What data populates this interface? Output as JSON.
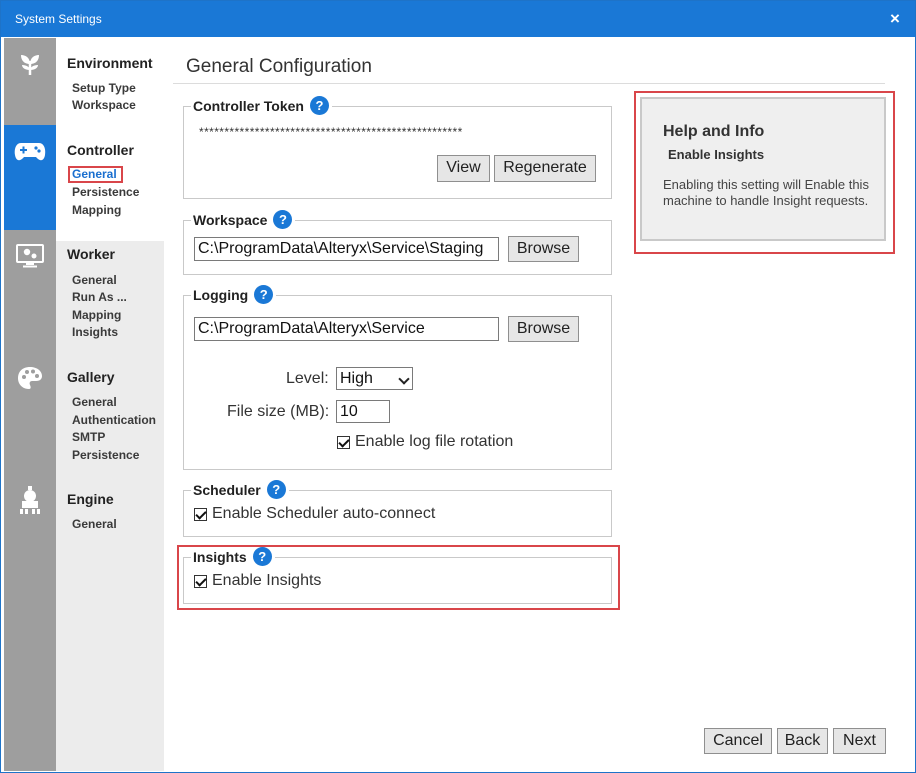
{
  "window": {
    "title": "System Settings",
    "close_glyph": "×"
  },
  "rail": {
    "icons": [
      "sprout-icon",
      "gamepad-icon",
      "monitor-gear-icon",
      "palette-icon",
      "engine-icon"
    ],
    "active_color": "#1a78d6"
  },
  "nav": {
    "sections": [
      {
        "title": "Environment",
        "items": [
          "Setup Type",
          "Workspace"
        ]
      },
      {
        "title": "Controller",
        "items": [
          "General",
          "Persistence",
          "Mapping"
        ]
      },
      {
        "title": "Worker",
        "items": [
          "General",
          "Run As ...",
          "Mapping",
          "Insights"
        ]
      },
      {
        "title": "Gallery",
        "items": [
          "General",
          "Authentication",
          "SMTP",
          "Persistence"
        ]
      },
      {
        "title": "Engine",
        "items": [
          "General"
        ]
      }
    ],
    "selected": "General"
  },
  "main": {
    "heading": "General Configuration",
    "controller_token": {
      "legend": "Controller Token",
      "token_value": "****************************************************",
      "view_label": "View",
      "regenerate_label": "Regenerate"
    },
    "workspace": {
      "legend": "Workspace",
      "path": "C:\\ProgramData\\Alteryx\\Service\\Staging",
      "browse_label": "Browse"
    },
    "logging": {
      "legend": "Logging",
      "path": "C:\\ProgramData\\Alteryx\\Service",
      "browse_label": "Browse",
      "level_label": "Level:",
      "level_value": "High",
      "file_size_label": "File size (MB):",
      "file_size_value": "10",
      "rotation_label": "Enable log file rotation"
    },
    "scheduler": {
      "legend": "Scheduler",
      "autoconnect_label": "Enable Scheduler auto-connect"
    },
    "insights": {
      "legend": "Insights",
      "enable_label": "Enable Insights"
    },
    "help_glyph": "?"
  },
  "help_panel": {
    "title": "Help and Info",
    "subtitle": "Enable Insights",
    "body": "Enabling this setting will Enable this machine to handle Insight requests."
  },
  "footer": {
    "cancel_label": "Cancel",
    "back_label": "Back",
    "next_label": "Next"
  },
  "colors": {
    "accent": "#1a78d6",
    "highlight": "#d9464a",
    "rail_bg": "#9e9e9e",
    "nav_bg": "#ececec"
  }
}
